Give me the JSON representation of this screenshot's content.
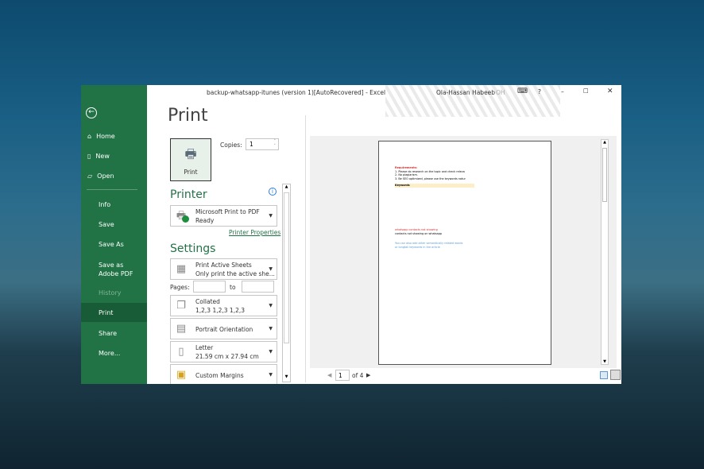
{
  "titlebar": {
    "title": "backup-whatsapp-itunes (version 1)[AutoRecovered]  -  Excel",
    "user": "Ola-Hassan Habeeb",
    "initials": "OH",
    "help": "?",
    "minimize": "–",
    "maximize": "☐",
    "close": "✕"
  },
  "sidebar": {
    "items": [
      {
        "label": "Home",
        "icon": "home-icon"
      },
      {
        "label": "New",
        "icon": "new-icon"
      },
      {
        "label": "Open",
        "icon": "open-icon"
      },
      {
        "label": "Info"
      },
      {
        "label": "Save"
      },
      {
        "label": "Save As"
      },
      {
        "label": "Save as Adobe PDF"
      },
      {
        "label": "History"
      },
      {
        "label": "Print"
      },
      {
        "label": "Share"
      },
      {
        "label": "More..."
      }
    ],
    "selected": "Print"
  },
  "print": {
    "title": "Print",
    "button": "Print",
    "copies_label": "Copies:",
    "copies_value": "1"
  },
  "printer": {
    "heading": "Printer",
    "name": "Microsoft Print to PDF",
    "status": "Ready",
    "properties_link": "Printer Properties"
  },
  "settings": {
    "heading": "Settings",
    "what": {
      "l1": "Print Active Sheets",
      "l2": "Only print the active she..."
    },
    "pages_label": "Pages:",
    "to_label": "to",
    "collate": {
      "l1": "Collated",
      "l2": "1,2,3    1,2,3    1,2,3"
    },
    "orientation": "Portrait Orientation",
    "paper": {
      "l1": "Letter",
      "l2": "21.59 cm x 27.94 cm"
    },
    "margins": "Custom Margins"
  },
  "preview": {
    "req_title": "Requirements:",
    "req_lines": [
      "1. Please do research on the topic and check releva",
      "2. No plagiarism.",
      "3. Be SEO optimized, please use the keywords natur"
    ],
    "keywords": "Keywords",
    "kw1": "whatsapp contacts not showing",
    "kw2": "contacts not showing on whatsapp",
    "note1": "You can also add other semantically related words",
    "note2": "or longtail keywords in the article",
    "page_current": "1",
    "page_of": "of 4"
  },
  "colors": {
    "accent": "#217346",
    "selected": "#185c37"
  }
}
